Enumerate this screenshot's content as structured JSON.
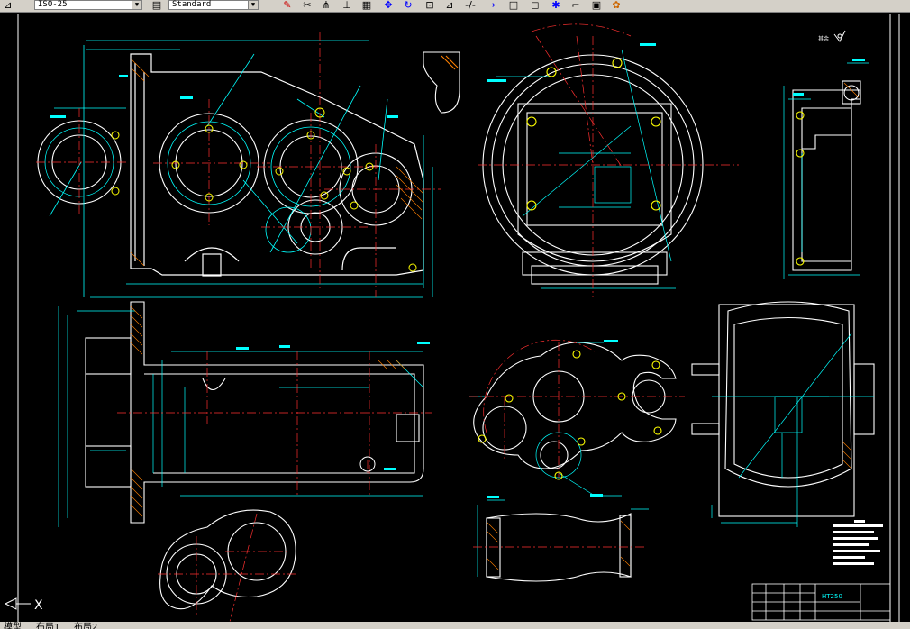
{
  "toolbar": {
    "dimstyle_value": "ISO-25",
    "textstyle_value": "Standard",
    "icons": [
      "pencil-icon",
      "dimension-icon",
      "text-style-icon",
      "edit-icon",
      "move-icon",
      "rotate-icon",
      "hatch-icon",
      "measure-icon",
      "arrow-icon",
      "box-icon",
      "rect-icon",
      "flip-icon",
      "zoom-icon",
      "paint-icon"
    ]
  },
  "drawing": {
    "surface_symbol_label": "其余",
    "material_label": "HT250"
  },
  "layout_tabs": {
    "model": "模型",
    "layout1": "布局1",
    "layout2": "布局2"
  },
  "colors": {
    "background": "#000000",
    "outline": "#ffffff",
    "dimension": "#00ffff",
    "centerline": "#ff3030",
    "hole": "#ffff00",
    "hatch": "#ff8000"
  }
}
